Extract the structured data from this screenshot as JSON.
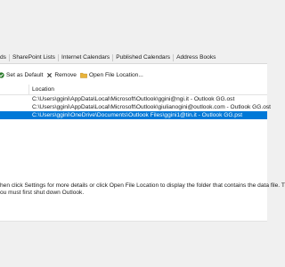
{
  "tabs": [
    {
      "label": "ds"
    },
    {
      "label": "SharePoint Lists"
    },
    {
      "label": "Internet Calendars"
    },
    {
      "label": "Published Calendars"
    },
    {
      "label": "Address Books"
    }
  ],
  "toolbar": {
    "set_default_label": "Set as Default",
    "remove_label": "Remove",
    "open_location_label": "Open File Location..."
  },
  "table": {
    "location_header": "Location",
    "rows": [
      {
        "location": "C:\\Users\\ggini\\AppData\\Local\\Microsoft\\Outlook\\ggini@ngi.it - Outlook GG.ost",
        "selected": false
      },
      {
        "location": "C:\\Users\\ggini\\AppData\\Local\\Microsoft\\Outlook\\giulianogini@outlook.com - Outlook GG.ost",
        "selected": false
      },
      {
        "location": "C:\\Users\\ggini\\OneDrive\\Documents\\Outlook Files\\ggini1@tin.it - Outlook GG.pst",
        "selected": true
      }
    ]
  },
  "help": {
    "line1": "hen click Settings for more details or click Open File Location to display the folder that contains the data file. T",
    "line2": "ou must first shut down Outlook."
  },
  "colors": {
    "selection": "#0078d7",
    "set_default_icon": "#2a7a2a",
    "remove_icon": "#333333",
    "folder_icon": "#e8b339"
  }
}
